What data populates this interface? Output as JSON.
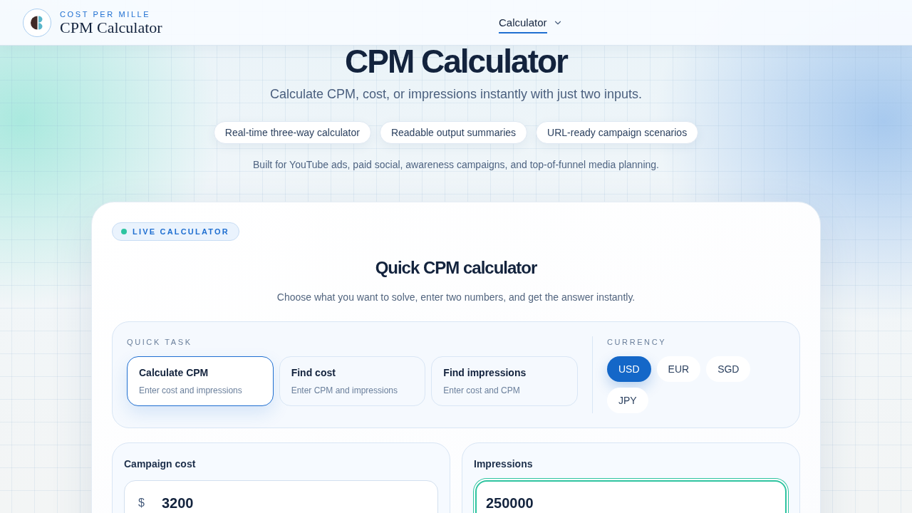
{
  "header": {
    "brand": {
      "eyebrow": "COST PER MILLE",
      "name": "CPM Calculator"
    },
    "nav": [
      {
        "label": "Calculator",
        "selected": true,
        "has_menu": true
      }
    ]
  },
  "hero": {
    "title": "CPM Calculator",
    "subtitle": "Calculate CPM, cost, or impressions instantly with just two inputs.",
    "features": [
      "Real-time three-way calculator",
      "Readable output summaries",
      "URL-ready campaign scenarios"
    ],
    "note": "Built for YouTube ads, paid social, awareness campaigns, and top-of-funnel media planning."
  },
  "calculator": {
    "badge": "LIVE CALCULATOR",
    "title": "Quick CPM calculator",
    "description": "Choose what you want to solve, enter two numbers, and get the answer instantly.",
    "quick_task": {
      "label": "QUICK TASK",
      "tasks": [
        {
          "title": "Calculate CPM",
          "hint": "Enter cost and impressions",
          "selected": true
        },
        {
          "title": "Find cost",
          "hint": "Enter CPM and impressions",
          "selected": false
        },
        {
          "title": "Find impressions",
          "hint": "Enter cost and CPM",
          "selected": false
        }
      ]
    },
    "currency": {
      "label": "CURRENCY",
      "options": [
        {
          "label": "USD",
          "selected": true
        },
        {
          "label": "EUR",
          "selected": false
        },
        {
          "label": "SGD",
          "selected": false
        },
        {
          "label": "JPY",
          "selected": false
        }
      ]
    },
    "inputs": [
      {
        "label": "Campaign cost",
        "prefix": "$",
        "value": "3200",
        "focused": false
      },
      {
        "label": "Impressions",
        "value": "250000",
        "focused": true
      }
    ]
  }
}
